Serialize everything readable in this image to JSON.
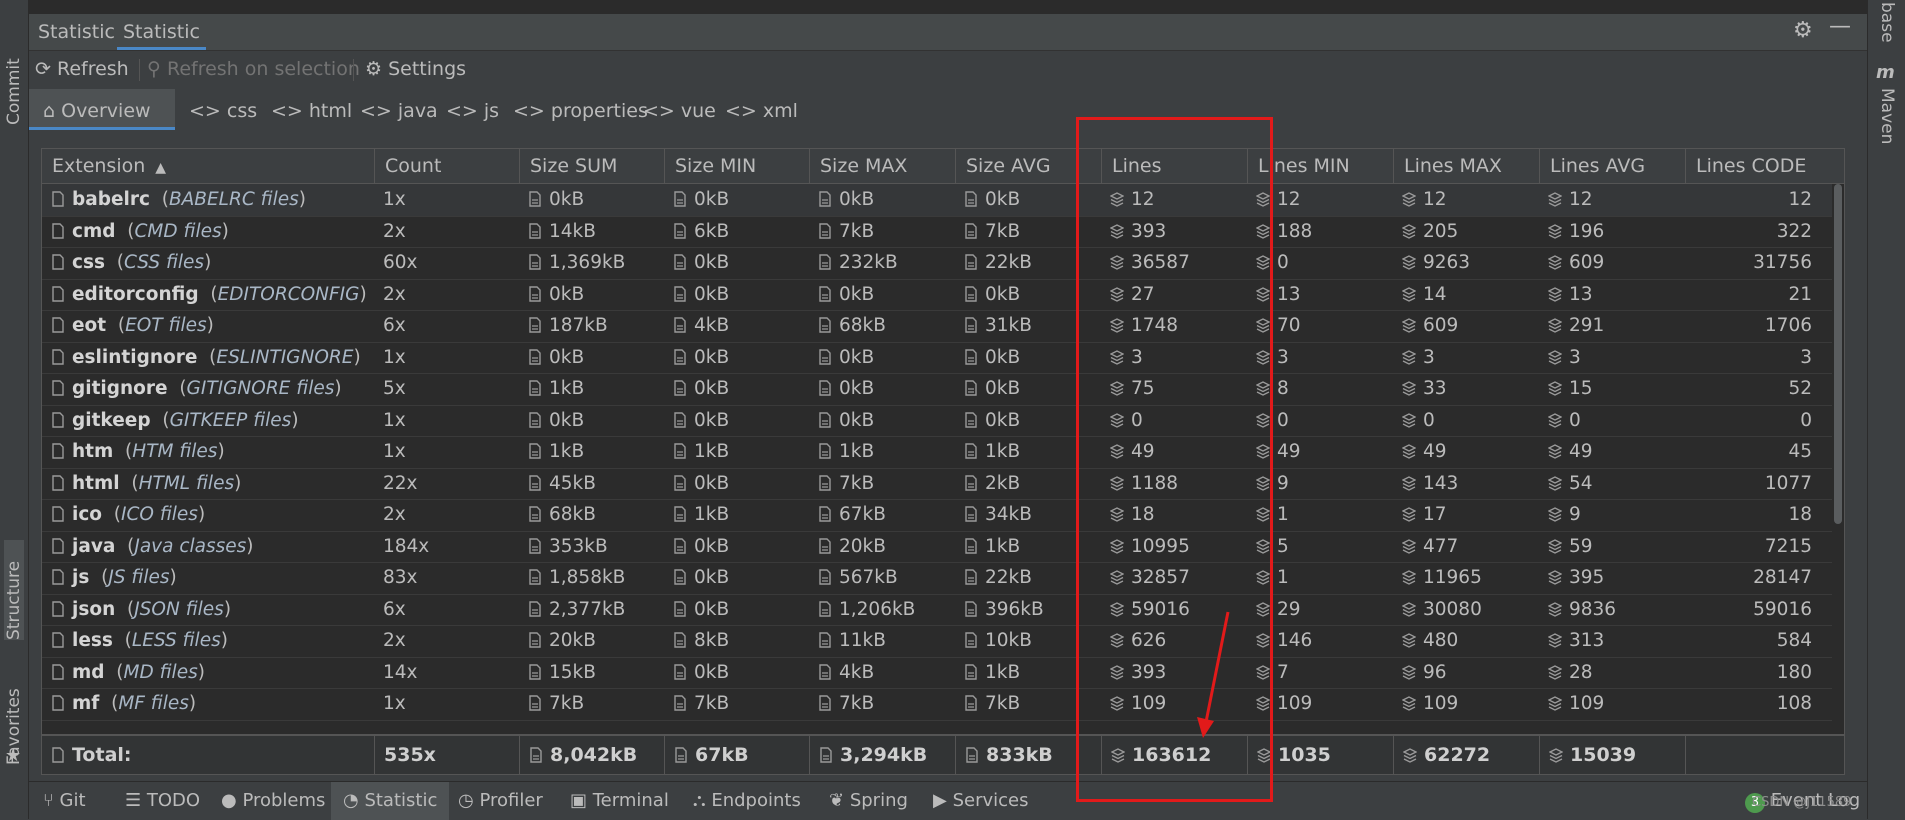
{
  "side_tabs": {
    "commit": "Commit",
    "structure": "Structure",
    "favorites": "Favorites",
    "maven": "Maven",
    "base": "base"
  },
  "panel": {
    "tabs": [
      "Statistic",
      "Statistic"
    ],
    "active_tab_index": 1
  },
  "toolbar": {
    "refresh": "Refresh",
    "refresh_selection": "Refresh on selection",
    "settings": "Settings"
  },
  "filetype_tabs": [
    "Overview",
    "css",
    "html",
    "java",
    "js",
    "properties",
    "vue",
    "xml"
  ],
  "table": {
    "headers": [
      "Extension",
      "Count",
      "Size SUM",
      "Size MIN",
      "Size MAX",
      "Size AVG",
      "Lines",
      "Lines MIN",
      "Lines MAX",
      "Lines AVG",
      "Lines CODE"
    ],
    "sort_indicator": "▲",
    "rows": [
      {
        "ext": "babelrc",
        "desc": "BABELRC files",
        "count": "1x",
        "sum": "0kB",
        "min": "0kB",
        "max": "0kB",
        "avg": "0kB",
        "lines": "12",
        "lmin": "12",
        "lmax": "12",
        "lavg": "12",
        "lcode": "12"
      },
      {
        "ext": "cmd",
        "desc": "CMD files",
        "count": "2x",
        "sum": "14kB",
        "min": "6kB",
        "max": "7kB",
        "avg": "7kB",
        "lines": "393",
        "lmin": "188",
        "lmax": "205",
        "lavg": "196",
        "lcode": "322"
      },
      {
        "ext": "css",
        "desc": "CSS files",
        "count": "60x",
        "sum": "1,369kB",
        "min": "0kB",
        "max": "232kB",
        "avg": "22kB",
        "lines": "36587",
        "lmin": "0",
        "lmax": "9263",
        "lavg": "609",
        "lcode": "31756"
      },
      {
        "ext": "editorconfig",
        "desc": "EDITORCONFIG",
        "count": "2x",
        "sum": "0kB",
        "min": "0kB",
        "max": "0kB",
        "avg": "0kB",
        "lines": "27",
        "lmin": "13",
        "lmax": "14",
        "lavg": "13",
        "lcode": "21"
      },
      {
        "ext": "eot",
        "desc": "EOT files",
        "count": "6x",
        "sum": "187kB",
        "min": "4kB",
        "max": "68kB",
        "avg": "31kB",
        "lines": "1748",
        "lmin": "70",
        "lmax": "609",
        "lavg": "291",
        "lcode": "1706"
      },
      {
        "ext": "eslintignore",
        "desc": "ESLINTIGNORE",
        "count": "1x",
        "sum": "0kB",
        "min": "0kB",
        "max": "0kB",
        "avg": "0kB",
        "lines": "3",
        "lmin": "3",
        "lmax": "3",
        "lavg": "3",
        "lcode": "3"
      },
      {
        "ext": "gitignore",
        "desc": "GITIGNORE files",
        "count": "5x",
        "sum": "1kB",
        "min": "0kB",
        "max": "0kB",
        "avg": "0kB",
        "lines": "75",
        "lmin": "8",
        "lmax": "33",
        "lavg": "15",
        "lcode": "52"
      },
      {
        "ext": "gitkeep",
        "desc": "GITKEEP files",
        "count": "1x",
        "sum": "0kB",
        "min": "0kB",
        "max": "0kB",
        "avg": "0kB",
        "lines": "0",
        "lmin": "0",
        "lmax": "0",
        "lavg": "0",
        "lcode": "0"
      },
      {
        "ext": "htm",
        "desc": "HTM files",
        "count": "1x",
        "sum": "1kB",
        "min": "1kB",
        "max": "1kB",
        "avg": "1kB",
        "lines": "49",
        "lmin": "49",
        "lmax": "49",
        "lavg": "49",
        "lcode": "45"
      },
      {
        "ext": "html",
        "desc": "HTML files",
        "count": "22x",
        "sum": "45kB",
        "min": "0kB",
        "max": "7kB",
        "avg": "2kB",
        "lines": "1188",
        "lmin": "9",
        "lmax": "143",
        "lavg": "54",
        "lcode": "1077"
      },
      {
        "ext": "ico",
        "desc": "ICO files",
        "count": "2x",
        "sum": "68kB",
        "min": "1kB",
        "max": "67kB",
        "avg": "34kB",
        "lines": "18",
        "lmin": "1",
        "lmax": "17",
        "lavg": "9",
        "lcode": "18"
      },
      {
        "ext": "java",
        "desc": "Java classes",
        "count": "184x",
        "sum": "353kB",
        "min": "0kB",
        "max": "20kB",
        "avg": "1kB",
        "lines": "10995",
        "lmin": "5",
        "lmax": "477",
        "lavg": "59",
        "lcode": "7215"
      },
      {
        "ext": "js",
        "desc": "JS files",
        "count": "83x",
        "sum": "1,858kB",
        "min": "0kB",
        "max": "567kB",
        "avg": "22kB",
        "lines": "32857",
        "lmin": "1",
        "lmax": "11965",
        "lavg": "395",
        "lcode": "28147"
      },
      {
        "ext": "json",
        "desc": "JSON files",
        "count": "6x",
        "sum": "2,377kB",
        "min": "0kB",
        "max": "1,206kB",
        "avg": "396kB",
        "lines": "59016",
        "lmin": "29",
        "lmax": "30080",
        "lavg": "9836",
        "lcode": "59016"
      },
      {
        "ext": "less",
        "desc": "LESS files",
        "count": "2x",
        "sum": "20kB",
        "min": "8kB",
        "max": "11kB",
        "avg": "10kB",
        "lines": "626",
        "lmin": "146",
        "lmax": "480",
        "lavg": "313",
        "lcode": "584"
      },
      {
        "ext": "md",
        "desc": "MD files",
        "count": "14x",
        "sum": "15kB",
        "min": "0kB",
        "max": "4kB",
        "avg": "1kB",
        "lines": "393",
        "lmin": "7",
        "lmax": "96",
        "lavg": "28",
        "lcode": "180"
      },
      {
        "ext": "mf",
        "desc": "MF files",
        "count": "1x",
        "sum": "7kB",
        "min": "7kB",
        "max": "7kB",
        "avg": "7kB",
        "lines": "109",
        "lmin": "109",
        "lmax": "109",
        "lavg": "109",
        "lcode": "108"
      }
    ],
    "total": {
      "label": "Total:",
      "count": "535x",
      "sum": "8,042kB",
      "min": "67kB",
      "max": "3,294kB",
      "avg": "833kB",
      "lines": "163612",
      "lmin": "1035",
      "lmax": "62272",
      "lavg": "15039"
    }
  },
  "bottom_tabs": [
    "Git",
    "TODO",
    "Problems",
    "Statistic",
    "Profiler",
    "Terminal",
    "Endpoints",
    "Spring",
    "Services"
  ],
  "bottom_active_index": 3,
  "event_log": {
    "badge": "3",
    "label": "Event Log"
  },
  "watermark": "CSDN @J11589",
  "colors": {
    "accent": "#4a88c7",
    "annotation": "#e21a1a",
    "background": "#3c3f41",
    "table_bg": "#2b2b2b"
  }
}
